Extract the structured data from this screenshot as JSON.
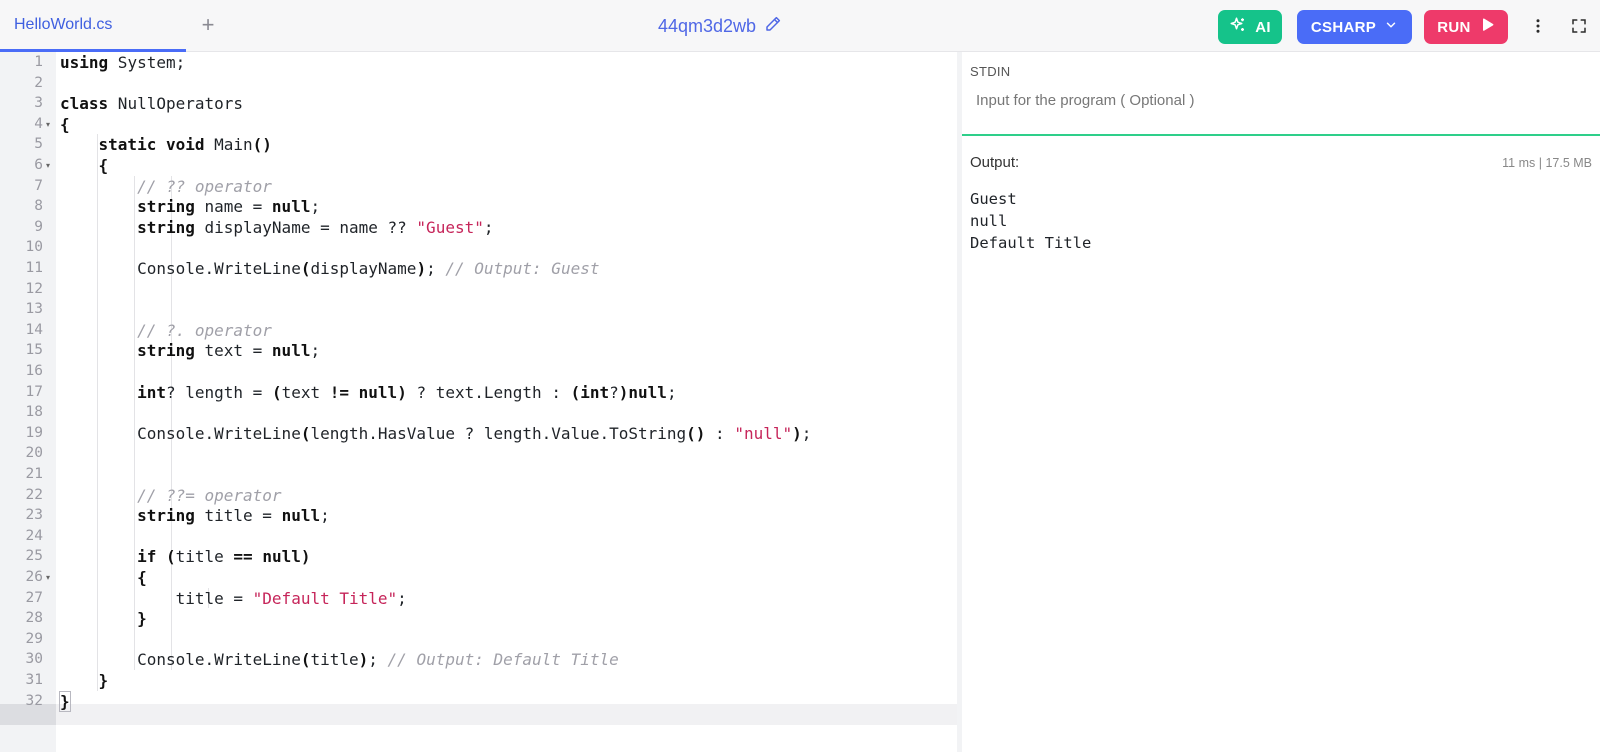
{
  "tab": {
    "filename": "HelloWorld.cs",
    "add_label": "+"
  },
  "project": {
    "name": "44qm3d2wb"
  },
  "toolbar": {
    "ai_label": "AI",
    "language_label": "CSHARP",
    "run_label": "RUN"
  },
  "colors": {
    "accent": "#4a6cf7",
    "ai": "#15c38a",
    "run": "#ee3a6a",
    "stdin_border": "#2ecf8a"
  },
  "icons": {
    "edit": "pencil-icon",
    "ai": "sparkle-icon",
    "dropdown": "chevron-down-icon",
    "run": "play-icon",
    "more": "more-vertical-icon",
    "fullscreen": "fullscreen-icon"
  },
  "editor": {
    "active_line": 32,
    "lines": [
      [
        {
          "t": "using",
          "c": "kw"
        },
        {
          "t": " System;"
        }
      ],
      [],
      [
        {
          "t": "class",
          "c": "kw"
        },
        {
          "t": " NullOperators"
        }
      ],
      [
        {
          "t": "{",
          "c": "kw"
        }
      ],
      [
        {
          "t": "    "
        },
        {
          "t": "static void",
          "c": "kw"
        },
        {
          "t": " Main"
        },
        {
          "t": "()",
          "c": "kw"
        }
      ],
      [
        {
          "t": "    "
        },
        {
          "t": "{",
          "c": "kw"
        }
      ],
      [
        {
          "t": "        "
        },
        {
          "t": "// ?? operator",
          "c": "cmt"
        }
      ],
      [
        {
          "t": "        "
        },
        {
          "t": "string",
          "c": "kw"
        },
        {
          "t": " name = "
        },
        {
          "t": "null",
          "c": "kw"
        },
        {
          "t": ";"
        }
      ],
      [
        {
          "t": "        "
        },
        {
          "t": "string",
          "c": "kw"
        },
        {
          "t": " displayName = name ?? "
        },
        {
          "t": "\"Guest\"",
          "c": "str"
        },
        {
          "t": ";"
        }
      ],
      [],
      [
        {
          "t": "        Console.WriteLine"
        },
        {
          "t": "(",
          "c": "kw"
        },
        {
          "t": "displayName"
        },
        {
          "t": ")",
          "c": "kw"
        },
        {
          "t": "; "
        },
        {
          "t": "// Output: Guest",
          "c": "cmt"
        }
      ],
      [],
      [],
      [
        {
          "t": "        "
        },
        {
          "t": "// ?. operator",
          "c": "cmt"
        }
      ],
      [
        {
          "t": "        "
        },
        {
          "t": "string",
          "c": "kw"
        },
        {
          "t": " text = "
        },
        {
          "t": "null",
          "c": "kw"
        },
        {
          "t": ";"
        }
      ],
      [],
      [
        {
          "t": "        "
        },
        {
          "t": "int",
          "c": "kw"
        },
        {
          "t": "? length = "
        },
        {
          "t": "(",
          "c": "kw"
        },
        {
          "t": "text "
        },
        {
          "t": "!=",
          "c": "kw"
        },
        {
          "t": " "
        },
        {
          "t": "null",
          "c": "kw"
        },
        {
          "t": ")",
          "c": "kw"
        },
        {
          "t": " ? text.Length : "
        },
        {
          "t": "(int",
          "c": "kw"
        },
        {
          "t": "?"
        },
        {
          "t": ")null",
          "c": "kw"
        },
        {
          "t": ";"
        }
      ],
      [],
      [
        {
          "t": "        Console.WriteLine"
        },
        {
          "t": "(",
          "c": "kw"
        },
        {
          "t": "length.HasValue ? length.Value.ToString"
        },
        {
          "t": "()",
          "c": "kw"
        },
        {
          "t": " : "
        },
        {
          "t": "\"null\"",
          "c": "str"
        },
        {
          "t": ")",
          "c": "kw"
        },
        {
          "t": ";"
        }
      ],
      [],
      [],
      [
        {
          "t": "        "
        },
        {
          "t": "// ??= operator",
          "c": "cmt"
        }
      ],
      [
        {
          "t": "        "
        },
        {
          "t": "string",
          "c": "kw"
        },
        {
          "t": " title = "
        },
        {
          "t": "null",
          "c": "kw"
        },
        {
          "t": ";"
        }
      ],
      [],
      [
        {
          "t": "        "
        },
        {
          "t": "if",
          "c": "kw"
        },
        {
          "t": " "
        },
        {
          "t": "(",
          "c": "kw"
        },
        {
          "t": "title "
        },
        {
          "t": "==",
          "c": "kw"
        },
        {
          "t": " "
        },
        {
          "t": "null",
          "c": "kw"
        },
        {
          "t": ")",
          "c": "kw"
        }
      ],
      [
        {
          "t": "        "
        },
        {
          "t": "{",
          "c": "kw"
        }
      ],
      [
        {
          "t": "            title = "
        },
        {
          "t": "\"Default Title\"",
          "c": "str"
        },
        {
          "t": ";"
        }
      ],
      [
        {
          "t": "        "
        },
        {
          "t": "}",
          "c": "kw"
        }
      ],
      [],
      [
        {
          "t": "        Console.WriteLine"
        },
        {
          "t": "(",
          "c": "kw"
        },
        {
          "t": "title"
        },
        {
          "t": ")",
          "c": "kw"
        },
        {
          "t": "; "
        },
        {
          "t": "// Output: Default Title",
          "c": "cmt"
        }
      ],
      [
        {
          "t": "    "
        },
        {
          "t": "}",
          "c": "kw"
        }
      ],
      [
        {
          "t": "}",
          "c": "kw hl"
        }
      ]
    ],
    "fold_lines": [
      4,
      6,
      26
    ]
  },
  "stdin": {
    "label": "STDIN",
    "placeholder": "Input for the program ( Optional )",
    "value": ""
  },
  "output": {
    "label": "Output:",
    "stats": "11 ms | 17.5 MB",
    "lines": [
      "Guest",
      "null",
      "Default Title"
    ]
  }
}
